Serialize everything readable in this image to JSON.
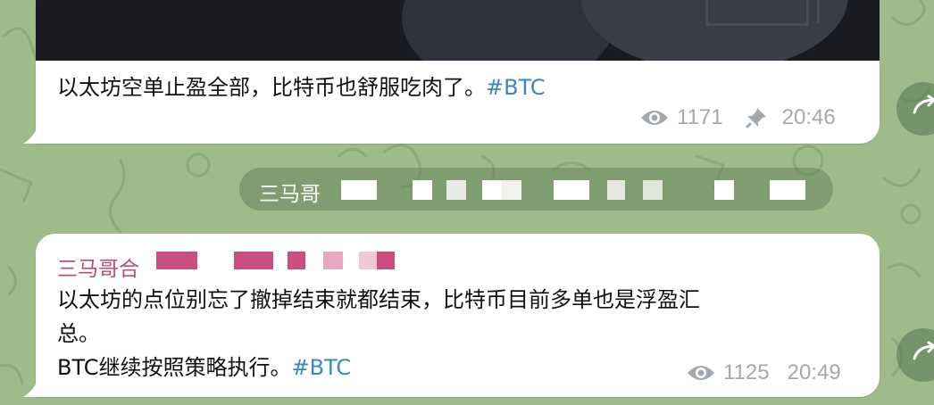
{
  "theme": {
    "wallpaper": "#9dbc8a",
    "bubble": "#ffffff",
    "text": "#111111",
    "meta": "#a3a9ae",
    "hashtag": "#3a86c9",
    "sender": "#c04a79",
    "service_text": "#ffffff"
  },
  "messages": [
    {
      "text": "以太坊空单止盈全部，比特币也舒服吃肉了。",
      "hashtag": "#BTC",
      "views": "1171",
      "time": "20:46",
      "pinned": true,
      "icons": [
        "eye-icon",
        "pin-icon"
      ]
    },
    {
      "sender": "三马哥合",
      "lines": [
        "以太坊的点位别忘了撤掉结束就都结束，比特币目前多单也是浮盈汇",
        "总。",
        "BTC继续按照策略执行。"
      ],
      "hashtag": "#BTC",
      "views": "1125",
      "time": "20:49",
      "icons": [
        "eye-icon"
      ]
    }
  ],
  "service": {
    "text": "三马哥"
  }
}
